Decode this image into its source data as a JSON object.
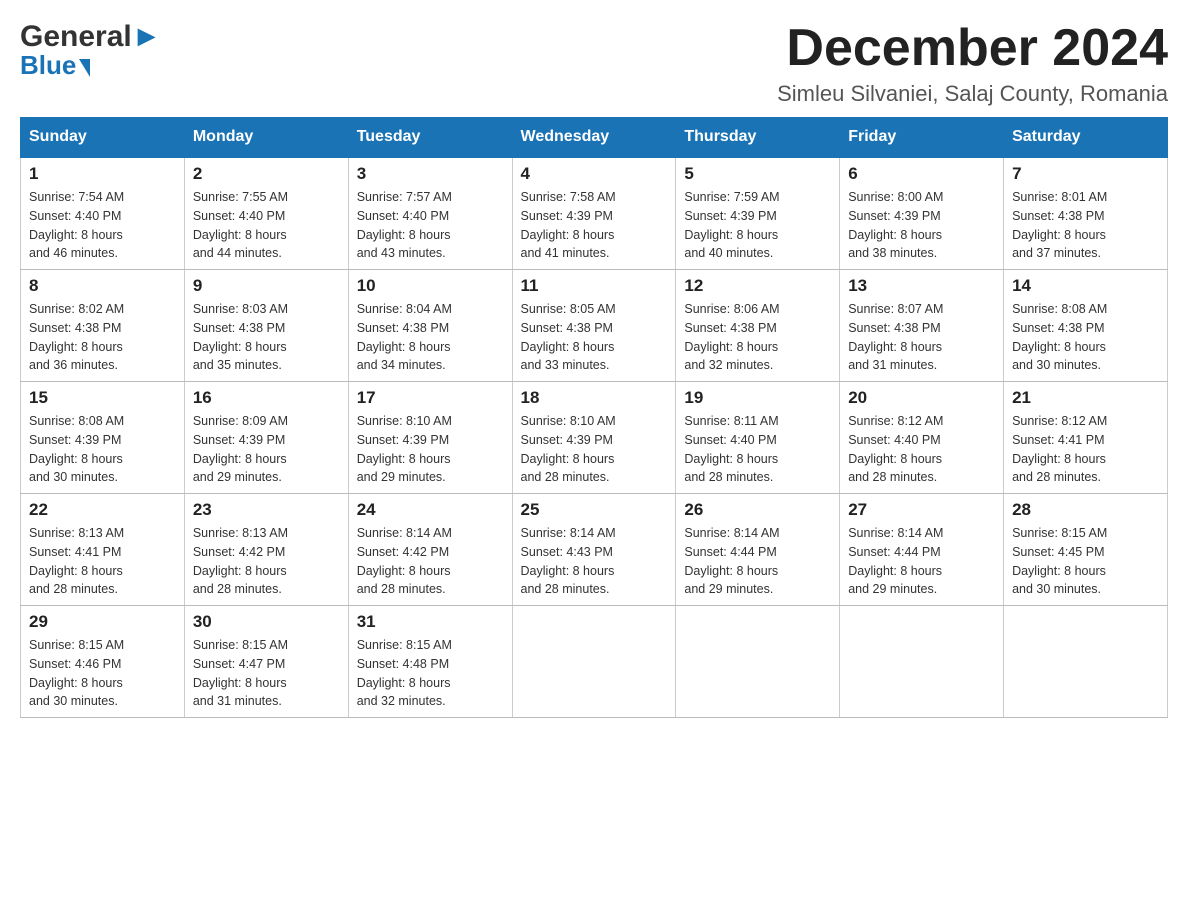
{
  "header": {
    "logo_general": "General",
    "logo_blue": "Blue",
    "month_title": "December 2024",
    "location": "Simleu Silvaniei, Salaj County, Romania"
  },
  "weekdays": [
    "Sunday",
    "Monday",
    "Tuesday",
    "Wednesday",
    "Thursday",
    "Friday",
    "Saturday"
  ],
  "weeks": [
    [
      {
        "day": "1",
        "sunrise": "Sunrise: 7:54 AM",
        "sunset": "Sunset: 4:40 PM",
        "daylight": "Daylight: 8 hours",
        "daylight2": "and 46 minutes."
      },
      {
        "day": "2",
        "sunrise": "Sunrise: 7:55 AM",
        "sunset": "Sunset: 4:40 PM",
        "daylight": "Daylight: 8 hours",
        "daylight2": "and 44 minutes."
      },
      {
        "day": "3",
        "sunrise": "Sunrise: 7:57 AM",
        "sunset": "Sunset: 4:40 PM",
        "daylight": "Daylight: 8 hours",
        "daylight2": "and 43 minutes."
      },
      {
        "day": "4",
        "sunrise": "Sunrise: 7:58 AM",
        "sunset": "Sunset: 4:39 PM",
        "daylight": "Daylight: 8 hours",
        "daylight2": "and 41 minutes."
      },
      {
        "day": "5",
        "sunrise": "Sunrise: 7:59 AM",
        "sunset": "Sunset: 4:39 PM",
        "daylight": "Daylight: 8 hours",
        "daylight2": "and 40 minutes."
      },
      {
        "day": "6",
        "sunrise": "Sunrise: 8:00 AM",
        "sunset": "Sunset: 4:39 PM",
        "daylight": "Daylight: 8 hours",
        "daylight2": "and 38 minutes."
      },
      {
        "day": "7",
        "sunrise": "Sunrise: 8:01 AM",
        "sunset": "Sunset: 4:38 PM",
        "daylight": "Daylight: 8 hours",
        "daylight2": "and 37 minutes."
      }
    ],
    [
      {
        "day": "8",
        "sunrise": "Sunrise: 8:02 AM",
        "sunset": "Sunset: 4:38 PM",
        "daylight": "Daylight: 8 hours",
        "daylight2": "and 36 minutes."
      },
      {
        "day": "9",
        "sunrise": "Sunrise: 8:03 AM",
        "sunset": "Sunset: 4:38 PM",
        "daylight": "Daylight: 8 hours",
        "daylight2": "and 35 minutes."
      },
      {
        "day": "10",
        "sunrise": "Sunrise: 8:04 AM",
        "sunset": "Sunset: 4:38 PM",
        "daylight": "Daylight: 8 hours",
        "daylight2": "and 34 minutes."
      },
      {
        "day": "11",
        "sunrise": "Sunrise: 8:05 AM",
        "sunset": "Sunset: 4:38 PM",
        "daylight": "Daylight: 8 hours",
        "daylight2": "and 33 minutes."
      },
      {
        "day": "12",
        "sunrise": "Sunrise: 8:06 AM",
        "sunset": "Sunset: 4:38 PM",
        "daylight": "Daylight: 8 hours",
        "daylight2": "and 32 minutes."
      },
      {
        "day": "13",
        "sunrise": "Sunrise: 8:07 AM",
        "sunset": "Sunset: 4:38 PM",
        "daylight": "Daylight: 8 hours",
        "daylight2": "and 31 minutes."
      },
      {
        "day": "14",
        "sunrise": "Sunrise: 8:08 AM",
        "sunset": "Sunset: 4:38 PM",
        "daylight": "Daylight: 8 hours",
        "daylight2": "and 30 minutes."
      }
    ],
    [
      {
        "day": "15",
        "sunrise": "Sunrise: 8:08 AM",
        "sunset": "Sunset: 4:39 PM",
        "daylight": "Daylight: 8 hours",
        "daylight2": "and 30 minutes."
      },
      {
        "day": "16",
        "sunrise": "Sunrise: 8:09 AM",
        "sunset": "Sunset: 4:39 PM",
        "daylight": "Daylight: 8 hours",
        "daylight2": "and 29 minutes."
      },
      {
        "day": "17",
        "sunrise": "Sunrise: 8:10 AM",
        "sunset": "Sunset: 4:39 PM",
        "daylight": "Daylight: 8 hours",
        "daylight2": "and 29 minutes."
      },
      {
        "day": "18",
        "sunrise": "Sunrise: 8:10 AM",
        "sunset": "Sunset: 4:39 PM",
        "daylight": "Daylight: 8 hours",
        "daylight2": "and 28 minutes."
      },
      {
        "day": "19",
        "sunrise": "Sunrise: 8:11 AM",
        "sunset": "Sunset: 4:40 PM",
        "daylight": "Daylight: 8 hours",
        "daylight2": "and 28 minutes."
      },
      {
        "day": "20",
        "sunrise": "Sunrise: 8:12 AM",
        "sunset": "Sunset: 4:40 PM",
        "daylight": "Daylight: 8 hours",
        "daylight2": "and 28 minutes."
      },
      {
        "day": "21",
        "sunrise": "Sunrise: 8:12 AM",
        "sunset": "Sunset: 4:41 PM",
        "daylight": "Daylight: 8 hours",
        "daylight2": "and 28 minutes."
      }
    ],
    [
      {
        "day": "22",
        "sunrise": "Sunrise: 8:13 AM",
        "sunset": "Sunset: 4:41 PM",
        "daylight": "Daylight: 8 hours",
        "daylight2": "and 28 minutes."
      },
      {
        "day": "23",
        "sunrise": "Sunrise: 8:13 AM",
        "sunset": "Sunset: 4:42 PM",
        "daylight": "Daylight: 8 hours",
        "daylight2": "and 28 minutes."
      },
      {
        "day": "24",
        "sunrise": "Sunrise: 8:14 AM",
        "sunset": "Sunset: 4:42 PM",
        "daylight": "Daylight: 8 hours",
        "daylight2": "and 28 minutes."
      },
      {
        "day": "25",
        "sunrise": "Sunrise: 8:14 AM",
        "sunset": "Sunset: 4:43 PM",
        "daylight": "Daylight: 8 hours",
        "daylight2": "and 28 minutes."
      },
      {
        "day": "26",
        "sunrise": "Sunrise: 8:14 AM",
        "sunset": "Sunset: 4:44 PM",
        "daylight": "Daylight: 8 hours",
        "daylight2": "and 29 minutes."
      },
      {
        "day": "27",
        "sunrise": "Sunrise: 8:14 AM",
        "sunset": "Sunset: 4:44 PM",
        "daylight": "Daylight: 8 hours",
        "daylight2": "and 29 minutes."
      },
      {
        "day": "28",
        "sunrise": "Sunrise: 8:15 AM",
        "sunset": "Sunset: 4:45 PM",
        "daylight": "Daylight: 8 hours",
        "daylight2": "and 30 minutes."
      }
    ],
    [
      {
        "day": "29",
        "sunrise": "Sunrise: 8:15 AM",
        "sunset": "Sunset: 4:46 PM",
        "daylight": "Daylight: 8 hours",
        "daylight2": "and 30 minutes."
      },
      {
        "day": "30",
        "sunrise": "Sunrise: 8:15 AM",
        "sunset": "Sunset: 4:47 PM",
        "daylight": "Daylight: 8 hours",
        "daylight2": "and 31 minutes."
      },
      {
        "day": "31",
        "sunrise": "Sunrise: 8:15 AM",
        "sunset": "Sunset: 4:48 PM",
        "daylight": "Daylight: 8 hours",
        "daylight2": "and 32 minutes."
      },
      null,
      null,
      null,
      null
    ]
  ]
}
